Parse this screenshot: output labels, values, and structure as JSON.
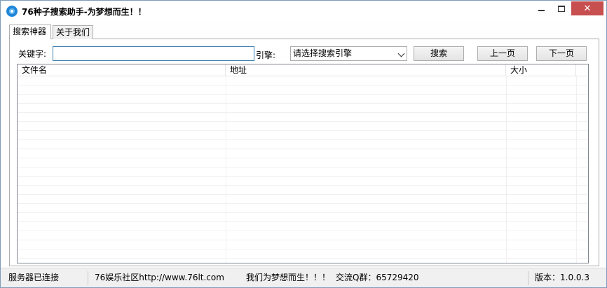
{
  "window": {
    "title": "76种子搜索助手-为梦想而生！！"
  },
  "tabs": [
    {
      "label": "搜索神器",
      "active": true
    },
    {
      "label": "关于我们",
      "active": false
    }
  ],
  "search": {
    "keyword_label": "关键字:",
    "keyword_value": "",
    "engine_label": "引擎:",
    "engine_selected": "请选择搜索引擎",
    "search_button": "搜索",
    "prev_button": "上一页",
    "next_button": "下一页"
  },
  "table": {
    "columns": [
      "文件名",
      "地址",
      "大小"
    ],
    "rows": []
  },
  "statusbar": {
    "connection": "服务器已连接",
    "site": "76娱乐社区http://www.76lt.com",
    "slogan": "我们为梦想而生！！！",
    "qq_group": "交流Q群：65729420",
    "version": "版本：1.0.0.3"
  },
  "colors": {
    "close_button": "#c74f4f",
    "accent": "#1f86d8"
  }
}
